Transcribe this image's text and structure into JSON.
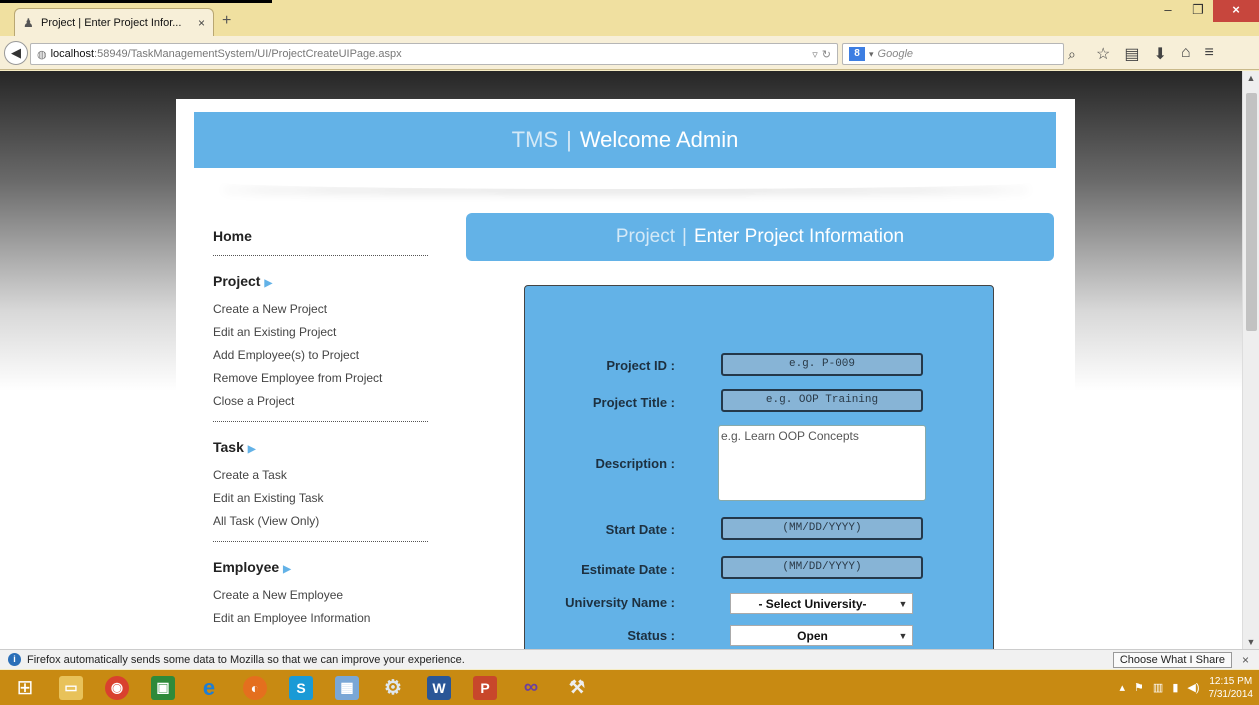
{
  "browser": {
    "tab_title": "Project | Enter Project Infor...",
    "tab_close": "×",
    "new_tab": "+",
    "url_host": "localhost",
    "url_rest": ":58949/TaskManagementSystem/UI/ProjectCreateUIPage.aspx",
    "search_placeholder": "Google",
    "search_engine_letter": "8",
    "window_controls": [
      "–",
      "❐",
      "×"
    ]
  },
  "header": {
    "brand": "TMS",
    "separator": "|",
    "welcome": "Welcome Admin"
  },
  "section": {
    "brand": "Project",
    "separator": "|",
    "title": "Enter Project Information"
  },
  "sidebar": {
    "home": "Home",
    "groups": [
      {
        "title": "Project",
        "links": [
          "Create a New Project",
          "Edit an Existing Project",
          "Add Employee(s) to Project",
          "Remove Employee from Project",
          "Close a Project"
        ]
      },
      {
        "title": "Task",
        "links": [
          "Create a Task",
          "Edit an Existing Task",
          "All Task (View Only)"
        ]
      },
      {
        "title": "Employee",
        "links": [
          "Create a New Employee",
          "Edit an Employee Information"
        ]
      }
    ]
  },
  "form": {
    "project_id": {
      "label": "Project ID :",
      "placeholder": "e.g. P-009"
    },
    "project_title": {
      "label": "Project Title :",
      "placeholder": "e.g. OOP Training"
    },
    "description": {
      "label": "Description :",
      "placeholder": "e.g. Learn OOP Concepts"
    },
    "start_date": {
      "label": "Start Date :",
      "placeholder": "(MM/DD/YYYY)"
    },
    "estimate_date": {
      "label": "Estimate Date :",
      "placeholder": "(MM/DD/YYYY)"
    },
    "university": {
      "label": "University Name :",
      "selected": "- Select University-"
    },
    "status": {
      "label": "Status :",
      "selected": "Open"
    }
  },
  "notification": {
    "message": "Firefox automatically sends some data to Mozilla so that we can improve your experience.",
    "button": "Choose What I Share",
    "close": "×"
  },
  "taskbar": {
    "time": "12:15 PM",
    "date": "7/31/2014"
  },
  "colors": {
    "accent_blue": "#63b2e7",
    "taskbar": "#c88a12",
    "close_red": "#c7463d"
  }
}
